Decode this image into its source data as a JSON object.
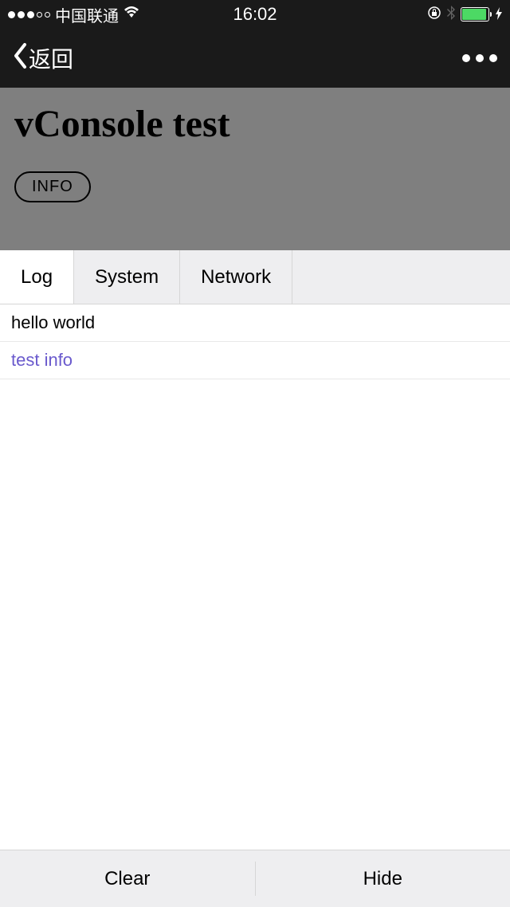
{
  "status": {
    "carrier": "中国联通",
    "time": "16:02"
  },
  "nav": {
    "back_label": "返回"
  },
  "page": {
    "title": "vConsole test",
    "info_button": "INFO"
  },
  "vconsole": {
    "tabs": {
      "log": "Log",
      "system": "System",
      "network": "Network"
    },
    "logs": [
      {
        "text": "hello world",
        "type": "log"
      },
      {
        "text": "test info",
        "type": "info"
      }
    ],
    "footer": {
      "clear": "Clear",
      "hide": "Hide"
    }
  }
}
